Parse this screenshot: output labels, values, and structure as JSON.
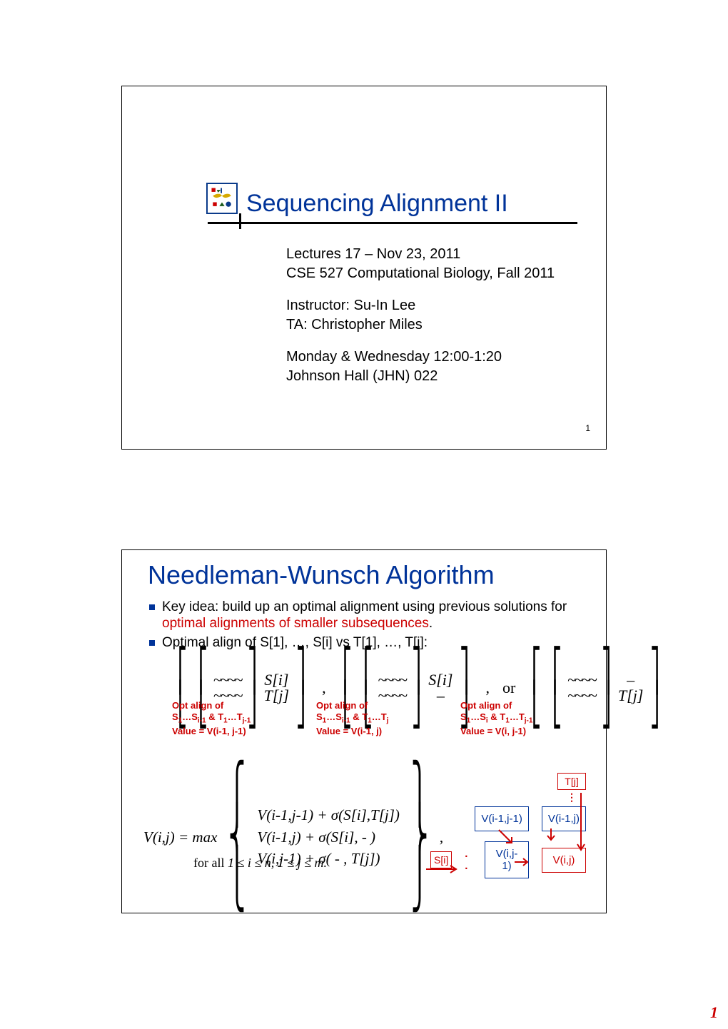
{
  "slide1": {
    "title": "Sequencing Alignment II",
    "line1": "Lectures 17 – Nov 23, 2011",
    "line2": "CSE 527 Computational Biology, Fall 2011",
    "line3": "Instructor: Su-In Lee",
    "line4": "TA: Christopher Miles",
    "line5": "Monday & Wednesday  12:00-1:20",
    "line6": "Johnson Hall (JHN) 022",
    "pagenum": "1"
  },
  "slide2": {
    "title": "Needleman-Wunsch Algorithm",
    "bullet1_a": "Key idea: build up an optimal alignment using previous solutions for ",
    "bullet1_b": "optimal alignments of smaller subsequences",
    "bullet1_c": ".",
    "bullet2": "Optimal align of S[1], …, S[i] vs T[1], …, T[j]:",
    "formrow": {
      "wave": "~~~~",
      "Si": "S[i]",
      "Tj": "T[j]",
      "dash": "–",
      "comma": ",",
      "or": "or"
    },
    "redgrp1": {
      "l1": "Opt align of",
      "l2a": "S",
      "l2b": "1",
      "l2c": "…S",
      "l2d": "i-1",
      "l2e": " & T",
      "l2f": "1",
      "l2g": "…T",
      "l2h": "j-1",
      "l3": "Value = V(i-1, j-1)"
    },
    "redgrp2": {
      "l1": "Opt align of",
      "l2a": "S",
      "l2b": "1",
      "l2c": "…S",
      "l2d": "i-1",
      "l2e": " & T",
      "l2f": "1",
      "l2g": "…T",
      "l2h": "j",
      "l3": "Value = V(i-1, j)"
    },
    "redgrp3": {
      "l1": "Opt align of",
      "l2a": "S",
      "l2b": "1",
      "l2c": "…S",
      "l2d": "i",
      "l2e": " & T",
      "l2f": "1",
      "l2g": "…T",
      "l2h": "j-1",
      "l3": "Value = V(i, j-1)"
    },
    "vij": {
      "lhs": "V(i,j)  =  max",
      "r1": "V(i-1,j-1) + σ(S[i],T[j])",
      "r2": "V(i-1,j)    + σ(S[i],  -  )",
      "r3": "V(i,j-1)    + σ( -  ,  T[j])",
      "tail": ","
    },
    "forall": {
      "a": "for all  ",
      "b": "1 ≤ i ≤ n,  1 ≤ j ≤ m."
    },
    "matrix": {
      "tlabel": "T[j]",
      "vdots": "⋮",
      "c11": "V(i-1,j-1)",
      "c12": "V(i-1,j)",
      "slabel": "S[i]",
      "hdots": ". .",
      "c21": "V(i,j-1)",
      "c22": "V(i,j)"
    }
  },
  "page_corner": "1"
}
